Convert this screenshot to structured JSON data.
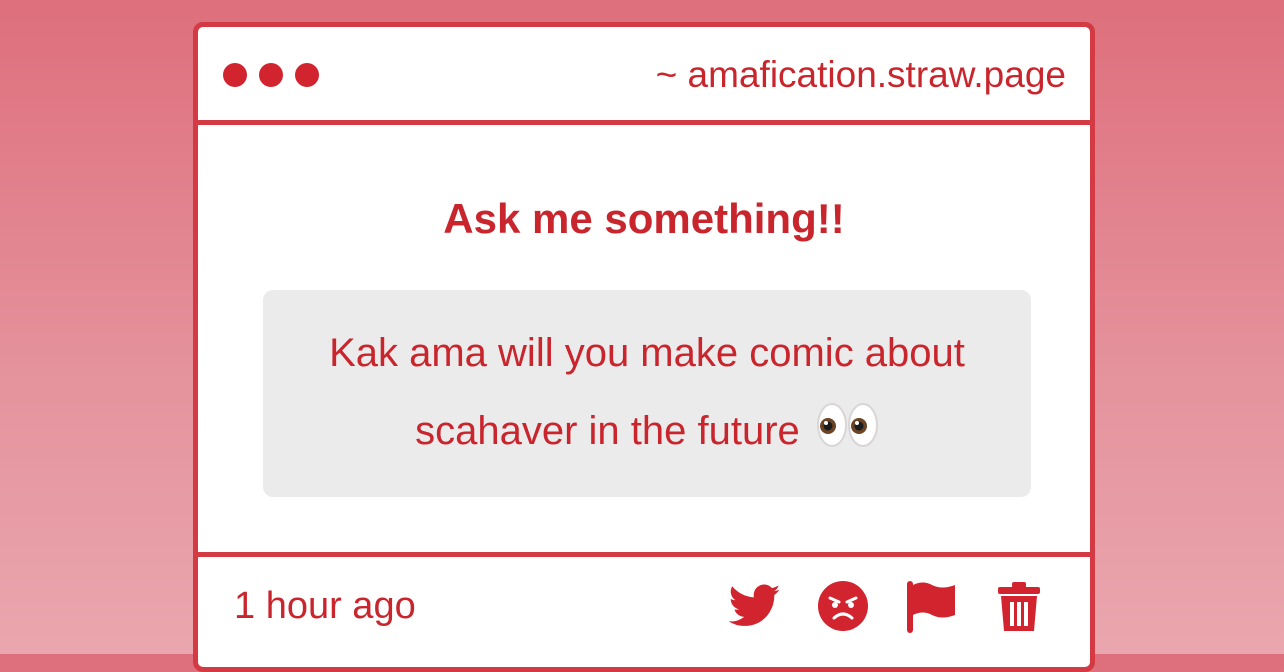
{
  "window": {
    "url_text": "~ amafication.straw.page"
  },
  "main": {
    "heading": "Ask me something!!",
    "question_line_1": "Kak ama will you make comic about",
    "question_line_2": "scahaver in the future",
    "question_emoji": "eyes-emoji"
  },
  "footer": {
    "timestamp": "1 hour ago",
    "actions": [
      "twitter-icon",
      "angry-face-icon",
      "flag-icon",
      "trash-icon"
    ]
  },
  "colors": {
    "accent": "#d33a43",
    "text": "#c9252d",
    "question_bg": "#ecebec"
  }
}
